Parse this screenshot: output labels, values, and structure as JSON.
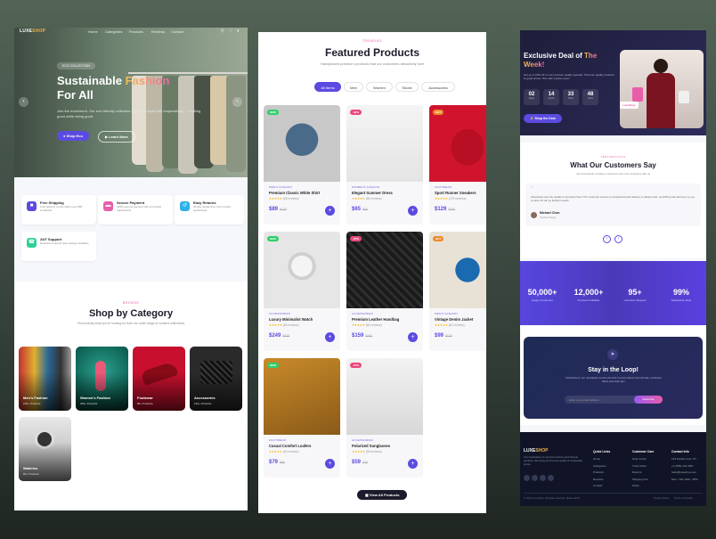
{
  "left": {
    "brand": {
      "a": "LUXE",
      "b": "SHOP"
    },
    "nav": [
      "Home",
      "Categories",
      "Products",
      "Reviews",
      "Contact"
    ],
    "hero": {
      "badge": "ECO COLLECTION",
      "title_a": "Sustainable",
      "title_b": "Fashion",
      "title_c": "For All",
      "desc": "Join the movement. Our eco-friendly collection combines style with responsibility — looking good while doing good.",
      "primary": "Shop Eco",
      "secondary": "Learn More"
    },
    "features": [
      {
        "title": "Free Shipping",
        "desc": "Free delivery on all orders over $50 worldwide",
        "icon": "truck-icon",
        "color": "#5b4be0"
      },
      {
        "title": "Secure Payment",
        "desc": "100% secure payment with encrypted transactions",
        "icon": "card-icon",
        "color": "#e85da8"
      },
      {
        "title": "Easy Returns",
        "desc": "30-day hassle-free return policy guaranteed",
        "icon": "return-icon",
        "color": "#2fb0e8"
      },
      {
        "title": "24/7 Support",
        "desc": "Dedicated support team always available",
        "icon": "headset-icon",
        "color": "#2fcf96"
      }
    ],
    "category": {
      "eyebrow": "BROWSE",
      "title": "Shop by Category",
      "desc": "Find exactly what you're looking for from our wide range of curated collections",
      "items": [
        {
          "name": "Men's Fashion",
          "count": "150+ Products"
        },
        {
          "name": "Women's Fashion",
          "count": "200+ Products"
        },
        {
          "name": "Footwear",
          "count": "80+ Products"
        },
        {
          "name": "Accessories",
          "count": "120+ Products"
        },
        {
          "name": "Watches",
          "count": "60+ Products"
        }
      ]
    }
  },
  "middle": {
    "eyebrow": "TRENDING",
    "title": "Featured Products",
    "desc": "Handpicked premium products that our customers absolutely love",
    "filters": [
      "All Items",
      "Men",
      "Women",
      "Shoes",
      "Accessories"
    ],
    "products": [
      {
        "cat": "MEN'S FASHION",
        "name": "Premium Classic White Shirt",
        "price": "$89",
        "old": "$120",
        "reviews": "(48 reviews)",
        "tag": "NEW",
        "tag_color": "#2fcf6a"
      },
      {
        "cat": "WOMEN'S FASHION",
        "name": "Elegant Summer Dress",
        "price": "$65",
        "old": "$95",
        "reviews": "(89 reviews)",
        "tag": "-30%",
        "tag_color": "#e84a7a"
      },
      {
        "cat": "FOOTWEAR",
        "name": "Sport Runner Sneakers",
        "price": "$129",
        "old": "$150",
        "reviews": "(275 reviews)",
        "tag": "HOT",
        "tag_color": "#f08a2a"
      },
      {
        "cat": "ACCESSORIES",
        "name": "Luxury Minimalist Watch",
        "price": "$249",
        "old": "$320",
        "reviews": "(56 reviews)",
        "tag": "NEW",
        "tag_color": "#2fcf6a"
      },
      {
        "cat": "ACCESSORIES",
        "name": "Premium Leather Handbag",
        "price": "$159",
        "old": "$200",
        "reviews": "(64 reviews)",
        "tag": "-25%",
        "tag_color": "#e84a7a"
      },
      {
        "cat": "MEN'S FASHION",
        "name": "Vintage Denim Jacket",
        "price": "$99",
        "old": "$130",
        "reviews": "(82 reviews)",
        "tag": "HOT",
        "tag_color": "#f08a2a"
      },
      {
        "cat": "FOOTWEAR",
        "name": "Casual Comfort Loafers",
        "price": "$79",
        "old": "$99",
        "reviews": "(40 reviews)",
        "tag": "NEW",
        "tag_color": "#2fcf6a"
      },
      {
        "cat": "ACCESSORIES",
        "name": "Polarized Sunglasses",
        "price": "$59",
        "old": "$79",
        "reviews": "(95 reviews)",
        "tag": "-15%",
        "tag_color": "#e84a7a"
      }
    ],
    "view_all": "View All Products"
  },
  "right": {
    "deal": {
      "title_a": "Exclusive Deal of",
      "title_b": "The",
      "title_c": "Week!",
      "desc": "Get up to 50% off on our premium quality specials. Premium quality products at great prices. This offer expires soon!",
      "timer": [
        {
          "v": "02",
          "u": "Days"
        },
        {
          "v": "14",
          "u": "Hours"
        },
        {
          "v": "33",
          "u": "Mins"
        },
        {
          "v": "48",
          "u": "Secs"
        }
      ],
      "button": "Shop the Deal",
      "img_badge": "LuxeShop"
    },
    "testimonials": {
      "eyebrow": "TESTIMONIALS",
      "title": "What Our Customers Say",
      "desc": "Join thousands of happy customers who love shopping with us",
      "quote": "Absolutely love the quality of products here! The customer service is exceptional and delivery is always fast. LuxeShop has become my go-to store for all my fashion needs.",
      "author": "Michael Chen",
      "role": "Verified Buyer"
    },
    "stats": [
      {
        "value": "50,000+",
        "label": "Happy Customers"
      },
      {
        "value": "12,000+",
        "label": "Products Available"
      },
      {
        "value": "95+",
        "label": "Countries Shipped"
      },
      {
        "value": "99%",
        "label": "Satisfaction Rate"
      }
    ],
    "newsletter": {
      "title": "Stay in the Loop!",
      "desc": "Subscribe to our newsletter and be the first to know about new arrivals, exclusive offers and style tips.",
      "placeholder": "Enter your email address...",
      "button": "Subscribe"
    },
    "footer": {
      "brand_a": "LUXE",
      "brand_b": "SHOP",
      "about": "Your destination for premium fashion and lifestyle products. We bring you the best quality at unbeatable prices.",
      "cols": [
        {
          "h": "Quick Links",
          "items": [
            "Home",
            "Categories",
            "Products",
            "Reviews",
            "Contact"
          ]
        },
        {
          "h": "Customer Care",
          "items": [
            "Help Center",
            "Track Order",
            "Returns",
            "Shipping Info",
            "FAQs"
          ]
        },
        {
          "h": "Contact Info",
          "items": [
            "123 Fashion Ave, NY",
            "+1 (555) 123-4567",
            "hello@luxeshop.com",
            "Mon - Sat: 9AM - 9PM"
          ]
        }
      ],
      "copyright": "© 2024 LuxeShop. All rights reserved. Made with ♥",
      "legal": [
        "Privacy Policy",
        "Terms of Service"
      ]
    }
  }
}
